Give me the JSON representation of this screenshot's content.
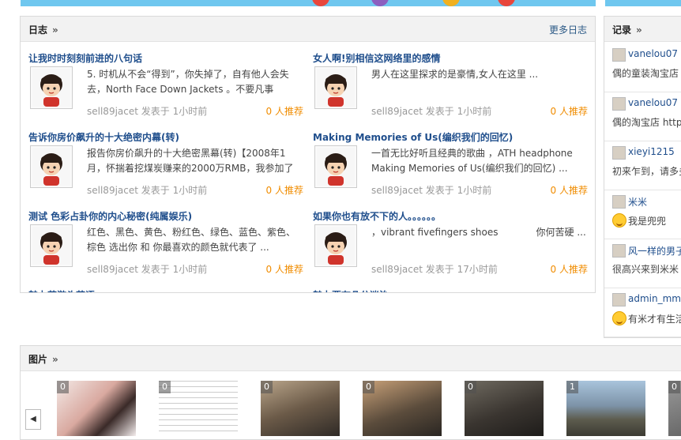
{
  "logs": {
    "title": "日志",
    "more": "更多日志",
    "entries": [
      {
        "title": "让我时时刻刻前进的八句话",
        "text": "5. 时机从不会“得到”，你失掉了，自有他人会失去，North Face Down Jackets 。不要凡事",
        "author": "sell89jacet",
        "posted": "发表于",
        "time": "1小时前",
        "recommend": "0 人推荐"
      },
      {
        "title": "女人啊!别相信这网络里的感情",
        "text": "男人在这里探求的是豪情,女人在这里 ...",
        "author": "sell89jacet",
        "posted": "发表于",
        "time": "1小时前",
        "recommend": "0 人推荐"
      },
      {
        "title": "告诉你房价飙升的十大绝密内幕(转)",
        "text": "报告你房价飙升的十大绝密黑幕(转)【2008年1月，怀揣着挖煤炭赚来的2000万RMB，我参加了",
        "author": "sell89jacet",
        "posted": "发表于",
        "time": "1小时前",
        "recommend": "0 人推荐"
      },
      {
        "title": "Making Memories of Us(编织我们的回忆)",
        "text": "一首无比好听且经典的歌曲 ，ATH headphone Making Memories of Us(编织我们的回忆) ...",
        "author": "sell89jacet",
        "posted": "发表于",
        "time": "1小时前",
        "recommend": "0 人推荐"
      },
      {
        "title": "测试 色彩占卦你的内心秘密(纯属娱乐)",
        "text": "红色、黑色、黄色、粉红色、绿色、蓝色、紫色、棕色 选出你 和 你最喜欢的颜色就代表了 ...",
        "author": "sell89jacet",
        "posted": "发表于",
        "time": "1小时前",
        "recommend": "0 人推荐"
      },
      {
        "title": "如果你也有放不下的人。。。。。。",
        "text": "，vibrant fivefingers shoes　　　　你何苦硬 ...",
        "author": "sell89jacet",
        "posted": "发表于",
        "time": "17小时前",
        "recommend": "0 人推荐"
      },
      {
        "title": "魅力苏游头苏语",
        "text": "",
        "author": "",
        "posted": "",
        "time": "",
        "recommend": ""
      },
      {
        "title": "魅力要有几分迷治",
        "text": "",
        "author": "",
        "posted": "",
        "time": "",
        "recommend": ""
      }
    ]
  },
  "records": {
    "title": "记录",
    "items": [
      {
        "name": "vanelou07",
        "text": "偶的童装淘宝店",
        "smiley": false
      },
      {
        "name": "vanelou07",
        "text": "偶的淘宝店 http",
        "smiley": false
      },
      {
        "name": "xieyi1215",
        "text": "初来乍到，请多多",
        "smiley": false
      },
      {
        "name": "米米",
        "text": "我是兜兜",
        "smiley": true
      },
      {
        "name": "风一样的男子",
        "text": "很高兴来到米米",
        "smiley": false
      },
      {
        "name": "admin_mm",
        "text": "有米才有生活",
        "smiley": true
      }
    ]
  },
  "photos": {
    "title": "图片",
    "prev_icon": "◀",
    "items": [
      {
        "count": "0"
      },
      {
        "count": "0"
      },
      {
        "count": "0"
      },
      {
        "count": "0"
      },
      {
        "count": "0"
      },
      {
        "count": "1"
      },
      {
        "count": "0"
      }
    ]
  },
  "colors": {
    "link": "#1f4e8c",
    "recommend": "#f08c00",
    "banner": "#6fc7ef"
  }
}
